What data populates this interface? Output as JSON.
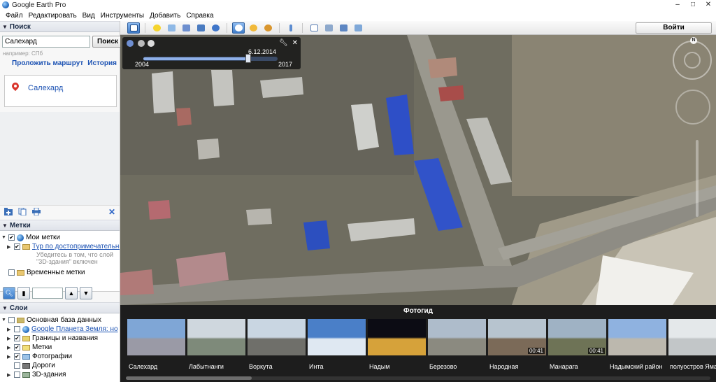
{
  "app": {
    "title": "Google Earth Pro",
    "window_controls": [
      "–",
      "□",
      "✕"
    ]
  },
  "menu": [
    "Файл",
    "Редактировать",
    "Вид",
    "Инструменты",
    "Добавить",
    "Справка"
  ],
  "search": {
    "header": "Поиск",
    "input_value": "Салехард",
    "button": "Поиск",
    "hint": "например: СПб",
    "link_route": "Проложить маршрут",
    "link_history": "История",
    "result": "Салехард"
  },
  "places": {
    "header": "Метки",
    "items": [
      {
        "label": "Мои метки"
      },
      {
        "label": "Тур по достопримечательно"
      },
      {
        "label": "Временные метки"
      }
    ],
    "note_line1": "Убедитесь в том, что слой",
    "note_line2": "\"3D-здания\" включен"
  },
  "layers": {
    "header": "Слои",
    "items": [
      {
        "label": "Основная база данных"
      },
      {
        "label": "Google Планета Земля: но"
      },
      {
        "label": "Границы и названия"
      },
      {
        "label": "Метки"
      },
      {
        "label": "Фотографии"
      },
      {
        "label": "Дороги"
      },
      {
        "label": "3D-здания"
      }
    ]
  },
  "toolbar": {
    "signin": "Войти"
  },
  "timeslider": {
    "date": "6.12.2014",
    "start_year": "2004",
    "end_year": "2017",
    "position": 0.78
  },
  "compass": {
    "north": "N"
  },
  "tour_guide": {
    "header": "Фотогид",
    "items": [
      {
        "caption": "Салехард",
        "duration": "",
        "sky": "#7fa6d6",
        "ground": "#9a9aa6"
      },
      {
        "caption": "Лабытнанги",
        "duration": "",
        "sky": "#cfd7de",
        "ground": "#7e8a7a"
      },
      {
        "caption": "Воркута",
        "duration": "",
        "sky": "#c9d6e2",
        "ground": "#6f6f6a"
      },
      {
        "caption": "Инта",
        "duration": "",
        "sky": "#4a7fc8",
        "ground": "#dfe8f2"
      },
      {
        "caption": "Надым",
        "duration": "",
        "sky": "#0c0c14",
        "ground": "#d6a23a"
      },
      {
        "caption": "Березово",
        "duration": "",
        "sky": "#aebccb",
        "ground": "#8b8a80"
      },
      {
        "caption": "Народная",
        "duration": "00:41",
        "sky": "#b7c4cf",
        "ground": "#7b6a58"
      },
      {
        "caption": "Манарага",
        "duration": "00:41",
        "sky": "#9fb2c4",
        "ground": "#6e7356"
      },
      {
        "caption": "Надымский район",
        "duration": "",
        "sky": "#8fb2e0",
        "ground": "#bcb8ae"
      },
      {
        "caption": "полуостров Ямал",
        "duration": "",
        "sky": "#e4e8ea",
        "ground": "#c2c6c8"
      }
    ]
  }
}
